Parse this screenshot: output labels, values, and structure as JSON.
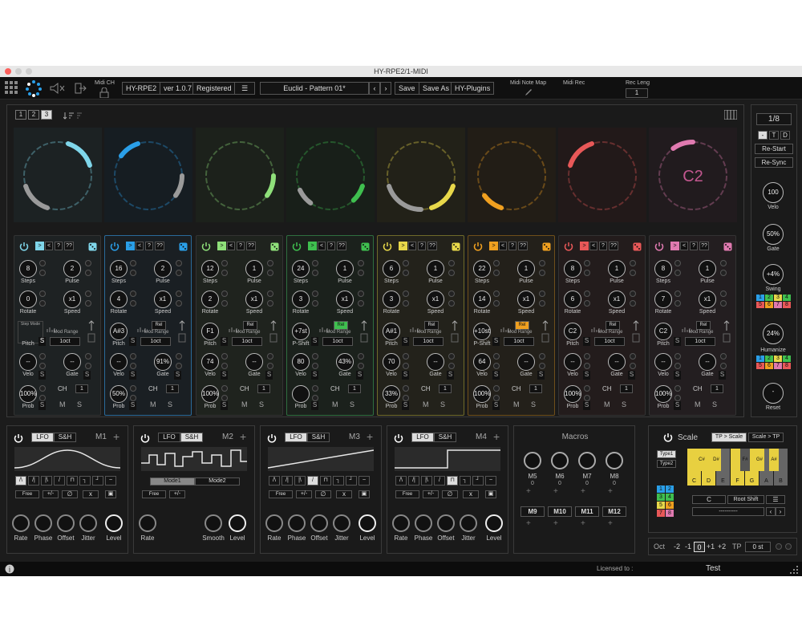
{
  "window": {
    "title": "HY-RPE2/1-MIDI"
  },
  "toolbar": {
    "midi_ch": "Midi CH",
    "product": "HY-RPE2",
    "version": "ver 1.0.7",
    "registered": "Registered",
    "preset": "Euclid - Pattern 01*",
    "save": "Save",
    "save_as": "Save As",
    "plugins": "HY-Plugins",
    "midi_note_map": "Midi Note Map",
    "midi_rec": "Midi Rec",
    "rec_leng": "Rec Leng",
    "rec_leng_value": "1"
  },
  "header": {
    "page_tabs": [
      "1",
      "2",
      "3"
    ],
    "active_page": "3"
  },
  "ring": {
    "center_text": "C2"
  },
  "lanes": [
    {
      "color": "#7fd6ea",
      "steps": "8",
      "pulse": "2",
      "rotate": "0",
      "speed": "x1",
      "pitch": "",
      "pitch_label": "Pitch",
      "step_mode": "Step Mode",
      "velo": "--",
      "gate": "--",
      "ch": "1",
      "prob": "100%",
      "mod_range": "Mod Range",
      "octave": "1oct"
    },
    {
      "color": "#2a9fe8",
      "steps": "16",
      "pulse": "2",
      "rotate": "4",
      "speed": "x1",
      "pitch": "A#3",
      "pitch_label": "Pitch",
      "velo": "--",
      "gate": "91%",
      "ch": "1",
      "prob": "50%",
      "mod_range": "Mod Range",
      "octave": "1oct",
      "rel": "Rel"
    },
    {
      "color": "#8fe07a",
      "steps": "12",
      "pulse": "1",
      "rotate": "2",
      "speed": "x1",
      "pitch": "F1",
      "pitch_label": "Pitch",
      "velo": "74",
      "gate": "--",
      "ch": "1",
      "prob": "100%",
      "mod_range": "Mod Range",
      "octave": "1oct",
      "rel": "Rel"
    },
    {
      "color": "#3fbf4f",
      "steps": "24",
      "pulse": "1",
      "rotate": "3",
      "speed": "x1",
      "pitch": "+7st",
      "pitch_label": "P-Shift",
      "velo": "80",
      "gate": "43%",
      "ch": "1",
      "prob": "",
      "mod_range": "Mod Range",
      "octave": "1oct",
      "rel": "Rel"
    },
    {
      "color": "#e8d84a",
      "steps": "6",
      "pulse": "1",
      "rotate": "3",
      "speed": "x1",
      "pitch": "A#1",
      "pitch_label": "Pitch",
      "velo": "70",
      "gate": "--",
      "ch": "1",
      "prob": "33%",
      "mod_range": "Mod Range",
      "octave": "1oct",
      "rel": "Rel"
    },
    {
      "color": "#f0a020",
      "steps": "22",
      "pulse": "1",
      "rotate": "14",
      "speed": "x1",
      "pitch": "+10st",
      "pitch_label": "P-Shift",
      "velo": "64",
      "gate": "--",
      "ch": "1",
      "prob": "100%",
      "mod_range": "Mod Range",
      "octave": "1oct",
      "rel": "Rel"
    },
    {
      "color": "#e85858",
      "steps": "8",
      "pulse": "1",
      "rotate": "6",
      "speed": "x1",
      "pitch": "C2",
      "pitch_label": "Pitch",
      "velo": "--",
      "gate": "--",
      "ch": "1",
      "prob": "100%",
      "mod_range": "Mod Range",
      "octave": "1oct",
      "rel": "Rel"
    },
    {
      "color": "#e07ab0",
      "steps": "8",
      "pulse": "1",
      "rotate": "7",
      "speed": "x1",
      "pitch": "C2",
      "pitch_label": "Pitch",
      "velo": "--",
      "gate": "--",
      "ch": "1",
      "prob": "100%",
      "mod_range": "Mod Range",
      "octave": "1oct",
      "rel": "Rel"
    }
  ],
  "lane_labels": {
    "steps": "Steps",
    "pulse": "Pulse",
    "rotate": "Rotate",
    "speed": "Speed",
    "velo": "Velo",
    "gate": "Gate",
    "prob": "Prob",
    "ch": "CH",
    "s": "S",
    "m": "M"
  },
  "side": {
    "rate": "1/8",
    "modes": [
      "-",
      "T",
      "D"
    ],
    "restart": "Re-Start",
    "resync": "Re-Sync",
    "velo_value": "100",
    "velo_label": "Velo",
    "gate_value": "50%",
    "gate_label": "Gate",
    "swing_value": "+4%",
    "swing_label": "Swing",
    "humanize_value": "24%",
    "humanize_label": "Humanize",
    "reset_label": "Reset",
    "grid": [
      "1",
      "2",
      "3",
      "4",
      "5",
      "6",
      "7",
      "8"
    ]
  },
  "mods": [
    {
      "label": "M1",
      "tab_lfo": "LFO",
      "tab_sh": "S&H",
      "shape": "sine",
      "sync": "Free",
      "knobs": [
        "Rate",
        "Phase",
        "Offset",
        "Jitter",
        "Level"
      ]
    },
    {
      "label": "M2",
      "tab_lfo": "LFO",
      "tab_sh": "S&H",
      "shape": "sh",
      "mode1": "Mode1",
      "mode2": "Mode2",
      "sync": "Free",
      "knobs": [
        "Rate",
        "Smooth",
        "Level"
      ]
    },
    {
      "label": "M3",
      "tab_lfo": "LFO",
      "tab_sh": "S&H",
      "shape": "ramp",
      "sync": "Free",
      "knobs": [
        "Rate",
        "Phase",
        "Offset",
        "Jitter",
        "Level"
      ]
    },
    {
      "label": "M4",
      "tab_lfo": "LFO",
      "tab_sh": "S&H",
      "shape": "square",
      "sync": "Free",
      "knobs": [
        "Rate",
        "Phase",
        "Offset",
        "Jitter",
        "Level"
      ]
    }
  ],
  "mod_buttons": {
    "bipolar": "+/-"
  },
  "macros": {
    "title": "Macros",
    "row1": [
      {
        "name": "M5",
        "value": "0"
      },
      {
        "name": "M6",
        "value": "0"
      },
      {
        "name": "M7",
        "value": "0"
      },
      {
        "name": "M8",
        "value": "0"
      }
    ],
    "row2": [
      "M9",
      "M10",
      "M11",
      "M12"
    ]
  },
  "scale": {
    "title": "Scale",
    "mode_tp": "TP > Scale",
    "mode_scale": "Scale > TP",
    "type1": "Type1",
    "type2": "Type2",
    "white_keys": [
      "C",
      "D",
      "E",
      "F",
      "G",
      "A",
      "B"
    ],
    "black_keys": [
      "C#",
      "D#",
      "",
      "F#",
      "G#",
      "A#"
    ],
    "root": "C",
    "root_shift": "Root Shift",
    "pattern": "----------",
    "grid": [
      "1",
      "2",
      "3",
      "4",
      "5",
      "6",
      "7",
      "8"
    ]
  },
  "octave": {
    "label": "Oct",
    "values": [
      "-2",
      "-1",
      "0",
      "+1",
      "+2"
    ],
    "active": "0",
    "tp_label": "TP",
    "tp_value": "0 st"
  },
  "status": {
    "licensed": "Licensed to :",
    "user": "Test"
  }
}
